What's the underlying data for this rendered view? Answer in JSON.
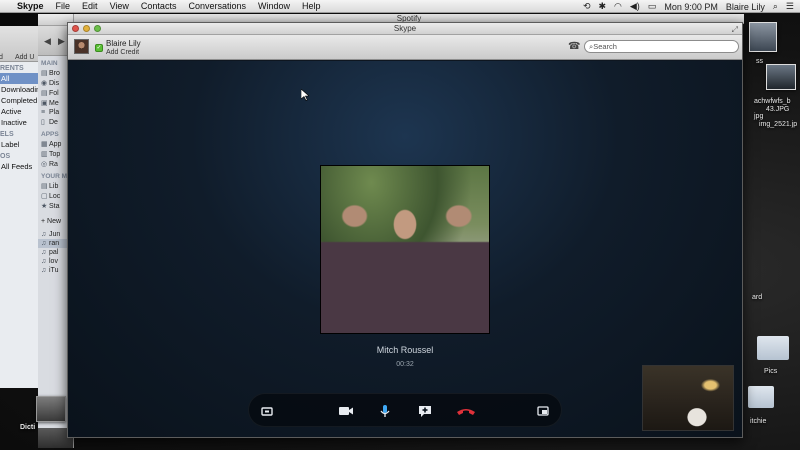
{
  "menubar": {
    "app": "Skype",
    "items": [
      "File",
      "Edit",
      "View",
      "Contacts",
      "Conversations",
      "Window",
      "Help"
    ],
    "clock": "Mon 9:00 PM",
    "user": "Blaire Lily"
  },
  "finder": {
    "toolbar_labels": [
      "d",
      "Add U"
    ],
    "sections": [
      {
        "title": "RENTS",
        "items": [
          "All",
          "Downloading",
          "Completed",
          "Active",
          "Inactive"
        ],
        "selected": 0
      },
      {
        "title": "ELS",
        "items": [
          "Label"
        ]
      },
      {
        "title": "OS",
        "items": [
          "All Feeds"
        ]
      }
    ]
  },
  "itunes": {
    "sections": [
      {
        "title": "MAIN",
        "items": [
          "Bro",
          "Dis",
          "Fol",
          "Me",
          "Pla",
          "De"
        ]
      },
      {
        "title": "APPS",
        "items": [
          "App",
          "Top",
          "Ra"
        ]
      },
      {
        "title": "YOUR M",
        "items": [
          "Lib",
          "Loc",
          "Sta"
        ]
      },
      {
        "title": "",
        "items": [
          "+ New"
        ]
      },
      {
        "title": "",
        "items": [
          "Jun",
          "ran",
          "pal",
          "lov",
          "iTu"
        ]
      }
    ]
  },
  "spotify": {
    "title": "Spotify"
  },
  "skype": {
    "title": "Skype",
    "user_name": "Blaire Lily",
    "add_credit": "Add Credit",
    "search_placeholder": "Search",
    "caller_name": "Mitch Roussel",
    "call_time": "00:32"
  },
  "desktop": {
    "labels": [
      "ss",
      "achwfwfs_b",
      "43.JPG",
      "jpg",
      "img_2521.jp",
      "ard",
      "Pics",
      "itchie",
      "Dicti"
    ]
  },
  "colors": {
    "hangup": "#e0313a",
    "presence": "#5ac035",
    "call_bg": "#101c2a"
  }
}
